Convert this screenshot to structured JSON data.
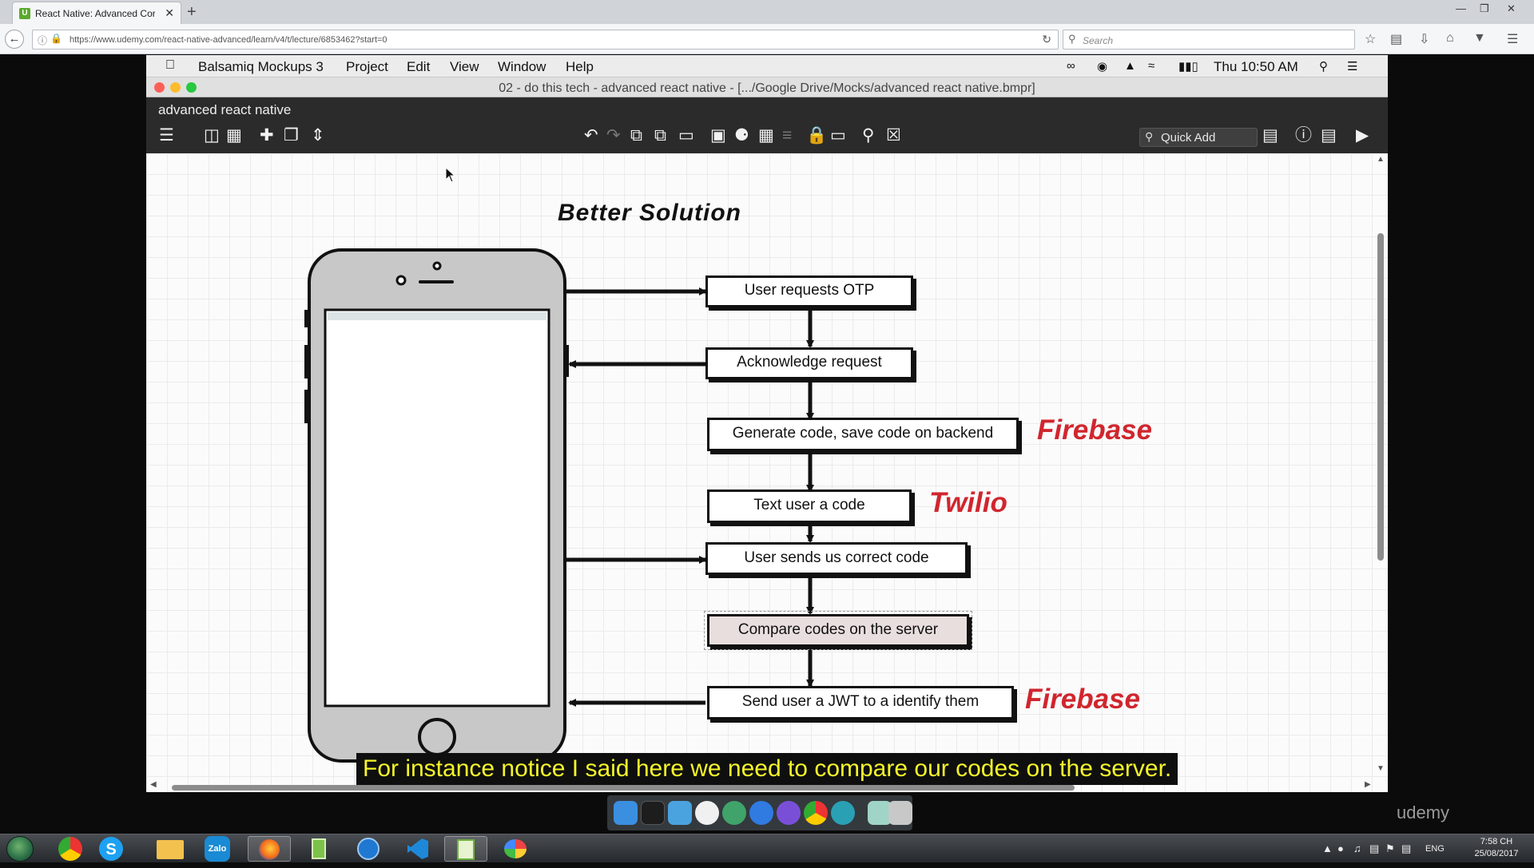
{
  "browser": {
    "tab_title": "React Native: Advanced Cor",
    "tab_favicon": "U",
    "url": "https://www.udemy.com/react-native-advanced/learn/v4/t/lecture/6853462?start=0",
    "search_placeholder": "Search"
  },
  "mac_menubar": {
    "items": [
      "Balsamiq Mockups 3",
      "Project",
      "Edit",
      "View",
      "Window",
      "Help"
    ],
    "clock": "Thu 10:50 AM"
  },
  "window": {
    "title": "02 - do this tech - advanced react native - [.../Google Drive/Mocks/advanced react native.bmpr]"
  },
  "balsamiq": {
    "project_name": "advanced react native",
    "quick_add_label": "Quick Add"
  },
  "diagram": {
    "title": "Better Solution",
    "steps": [
      "User requests OTP",
      "Acknowledge request",
      "Generate code, save code on backend",
      "Text user a code",
      "User sends us correct code",
      "Compare codes on the server",
      "Send user a JWT to a identify them"
    ],
    "services": [
      "Firebase",
      "Twilio",
      "Firebase"
    ]
  },
  "subtitle": "For instance notice I said here we need to compare our codes on the server.",
  "watermark": "udemy",
  "taskbar": {
    "lang": "ENG",
    "time": "7:58 CH",
    "date": "25/08/2017",
    "zalo_label": "Zalo"
  },
  "colors": {
    "service_red": "#d0262e",
    "subtitle_yellow": "#f5f52a",
    "toolbar_dark": "#2b2b2b"
  }
}
